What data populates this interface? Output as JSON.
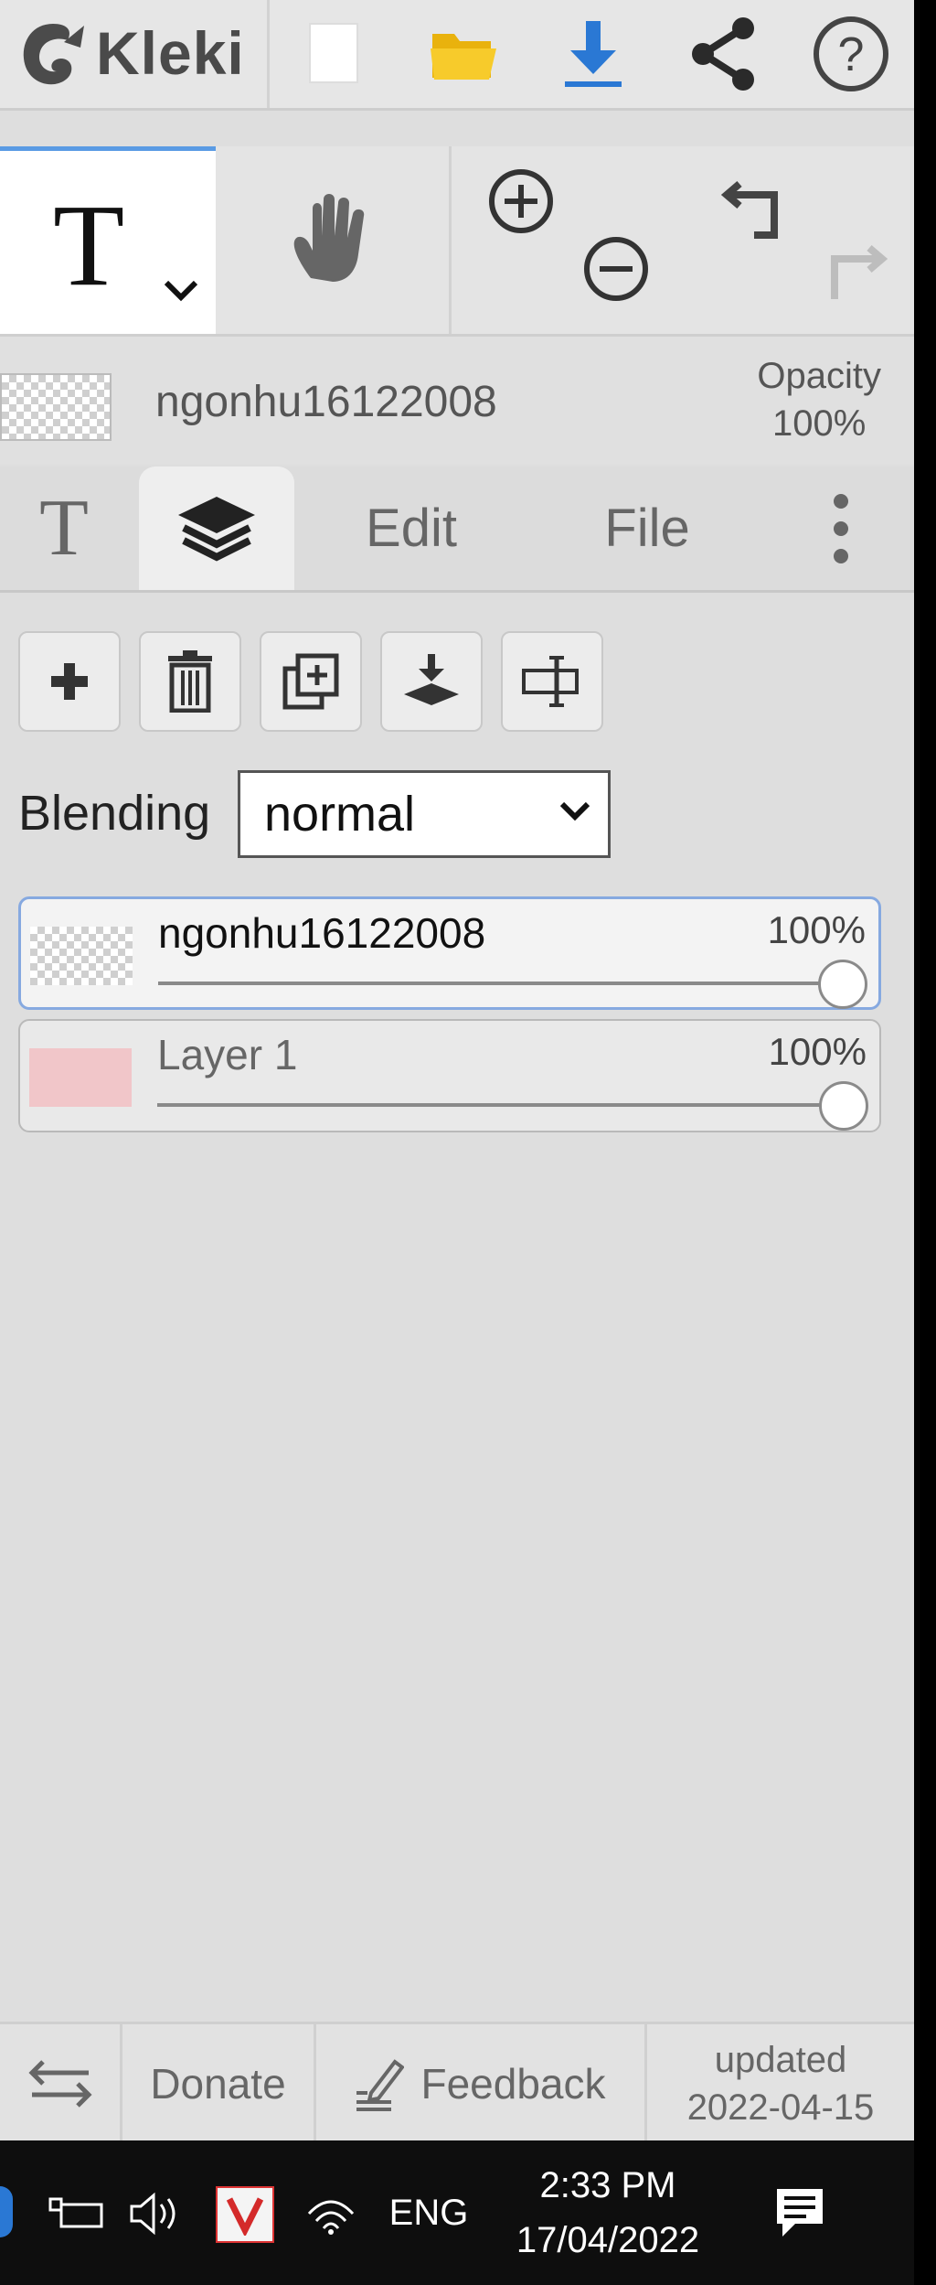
{
  "app": {
    "logo_text": "Kleki"
  },
  "tools": {
    "text_tool_glyph": "T",
    "hand_tool_icon": "hand-icon"
  },
  "layer_info": {
    "name": "ngonhu16122008",
    "opacity_label": "Opacity",
    "opacity_value": "100%"
  },
  "tabs": [
    {
      "label": "T",
      "icon": "text-tool-tab"
    },
    {
      "label": "",
      "icon": "layers-icon"
    },
    {
      "label": "Edit"
    },
    {
      "label": "File"
    }
  ],
  "blending": {
    "label": "Blending",
    "value": "normal"
  },
  "layers": [
    {
      "name": "ngonhu16122008",
      "opacity": "100%",
      "opacity_fraction": 1.0,
      "selected": true,
      "thumb_color": "#ffffff"
    },
    {
      "name": "Layer 1",
      "opacity": "100%",
      "opacity_fraction": 1.0,
      "selected": false,
      "thumb_color": "#f1c6c9"
    }
  ],
  "footer": {
    "donate": "Donate",
    "feedback": "Feedback",
    "updated_label": "updated",
    "updated_date": "2022-04-15"
  },
  "taskbar": {
    "language": "ENG",
    "time": "2:33 PM",
    "date": "17/04/2022"
  },
  "colors": {
    "accent": "#2a78d4",
    "folder": "#f2c21b",
    "panel_bg": "#dedede"
  }
}
